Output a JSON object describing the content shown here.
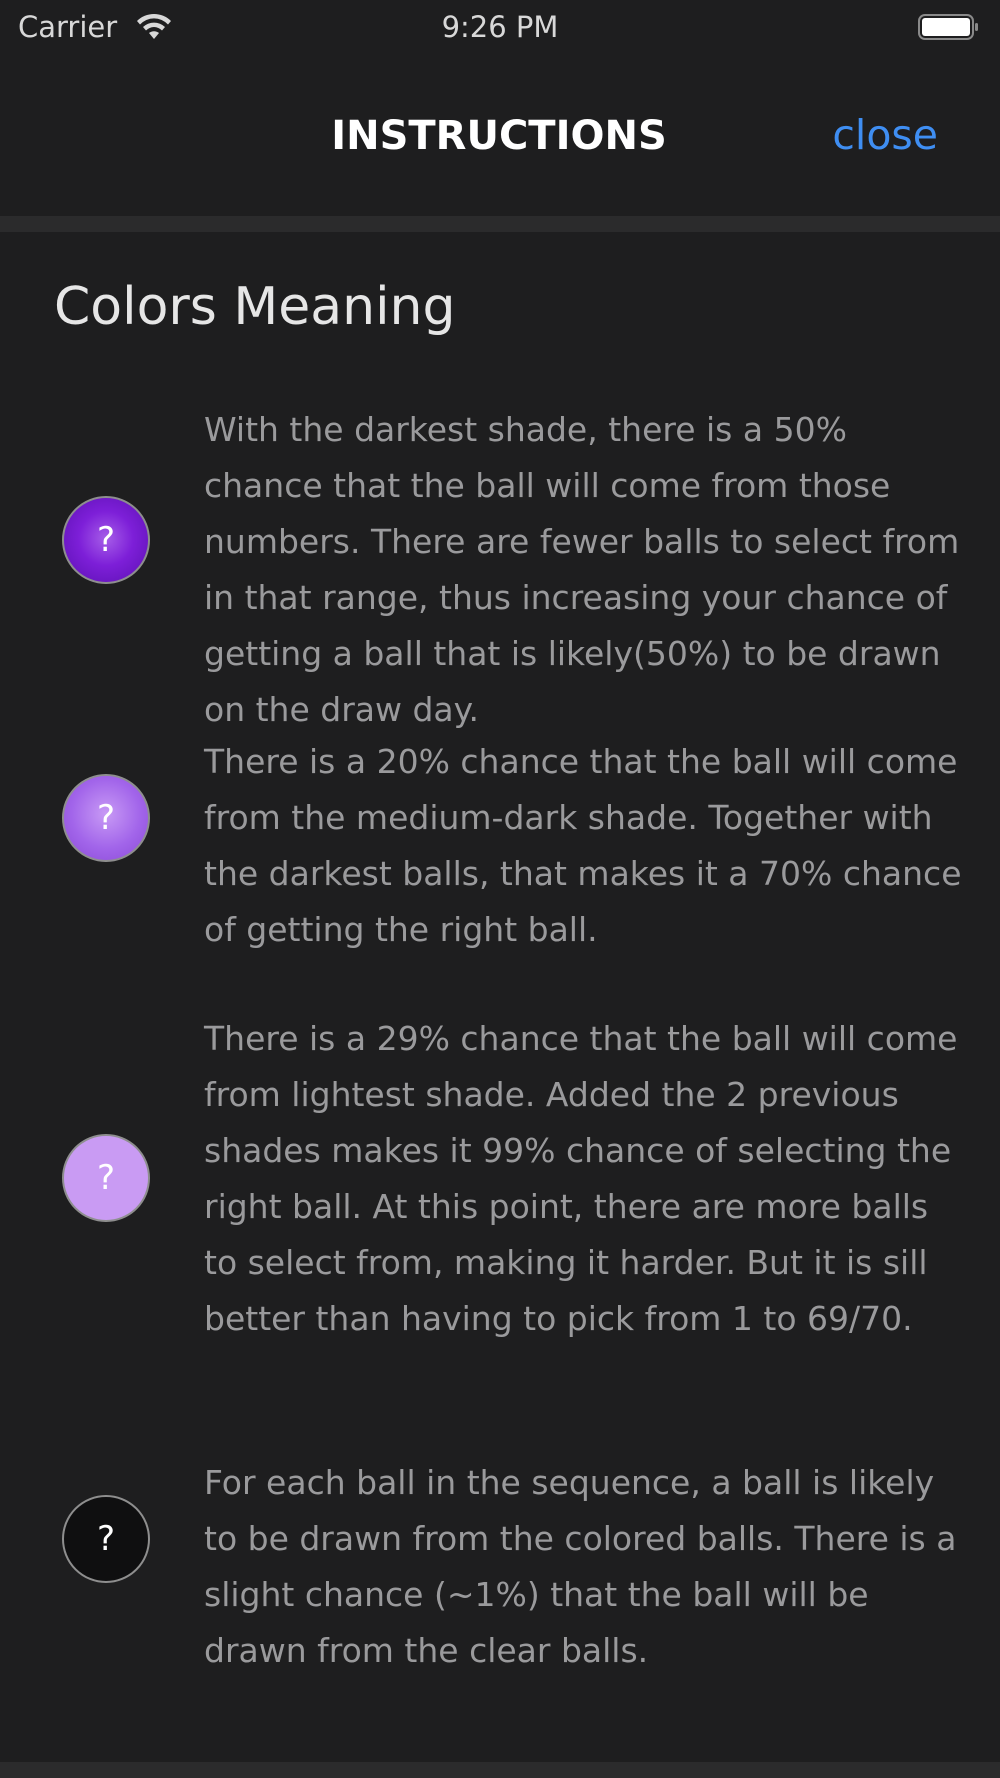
{
  "status_bar": {
    "carrier": "Carrier",
    "time": "9:26 PM"
  },
  "nav": {
    "title": "INSTRUCTIONS",
    "close_label": "close"
  },
  "section": {
    "title": "Colors Meaning"
  },
  "rows": [
    {
      "ball_label": "?",
      "ball_color": "#7d1fd8",
      "text": "With the darkest shade, there is a 50% chance that the ball will come from those numbers. There are fewer balls to select from in that range, thus increasing your chance of getting a ball that is likely(50%) to be drawn on the draw day."
    },
    {
      "ball_label": "?",
      "ball_color": "#a265ea",
      "text": "There is a 20% chance that the ball will come from the medium-dark shade. Together with the darkest balls, that makes it a 70% chance of getting the right ball."
    },
    {
      "ball_label": "?",
      "ball_color": "#c99bf3",
      "text": "There is a 29% chance that the ball will come from lightest shade. Added the 2 previous shades makes it 99% chance of selecting the right ball. At this point, there are more balls to select from, making it harder. But it is sill better than having to pick from 1 to 69/70."
    },
    {
      "ball_label": "?",
      "ball_color": "#0f0f10",
      "text": "For each ball in the sequence, a ball is likely to be drawn from the colored balls. There is a slight chance (~1%) that the ball will be drawn from the clear balls."
    }
  ],
  "colors": {
    "background": "#1e1e1f",
    "accent": "#3f8ef2",
    "body_text": "#9a9a9c"
  }
}
